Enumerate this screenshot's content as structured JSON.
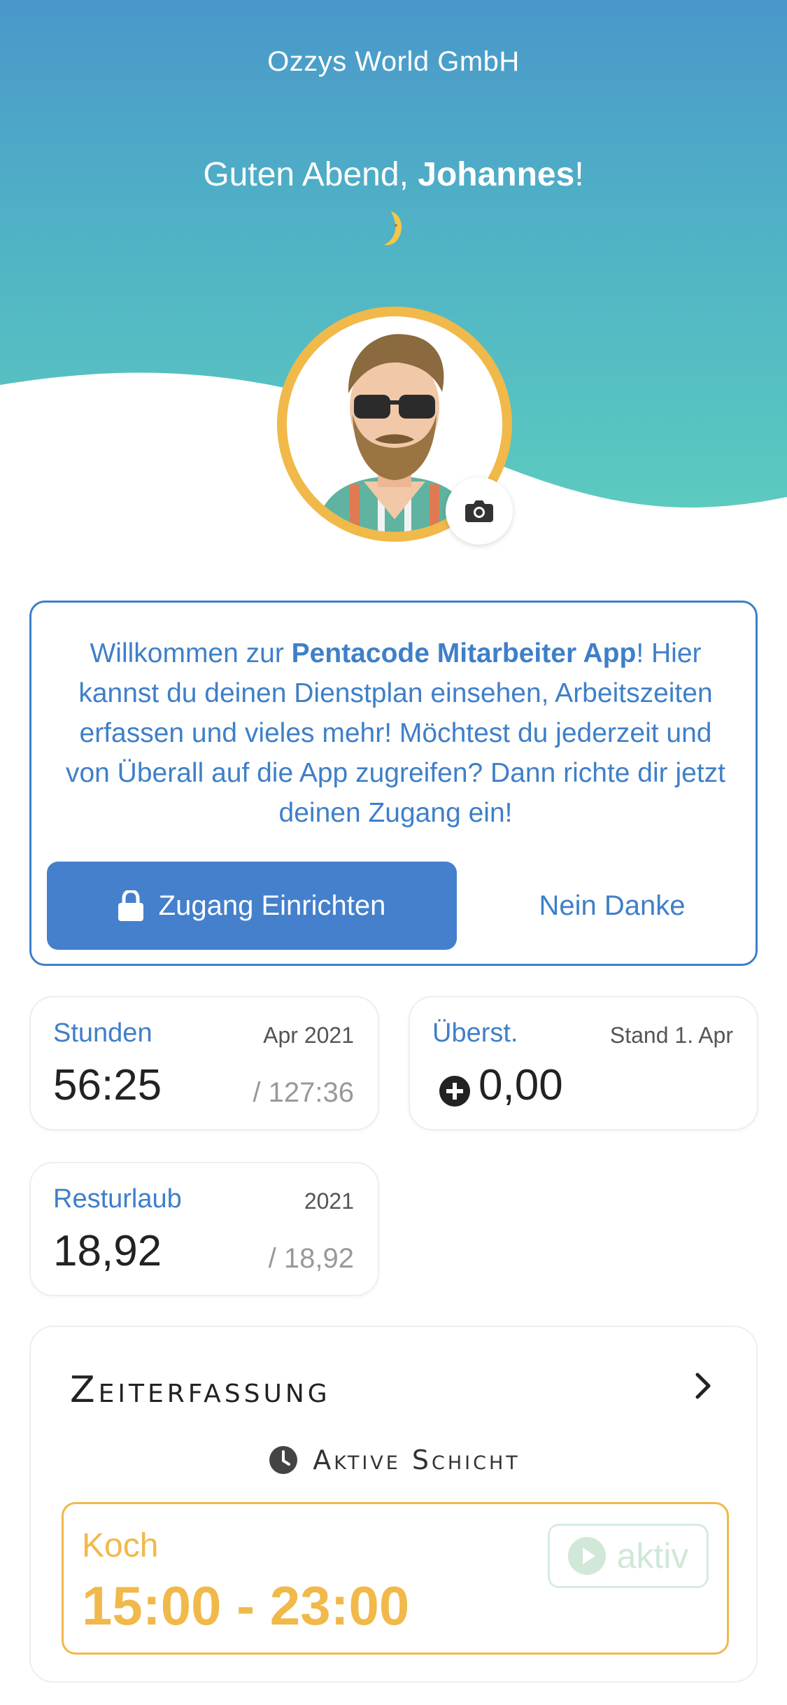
{
  "header": {
    "company": "Ozzys World GmbH",
    "greeting_prefix": "Guten Abend,",
    "user_name": "Johannes",
    "greeting_suffix": "!",
    "moon_icon": "crescent-moon-icon"
  },
  "profile": {
    "camera_icon": "camera-icon"
  },
  "welcome": {
    "text_before": "Willkommen zur ",
    "app_name": "Pentacode Mitarbeiter App",
    "text_after": "! Hier kannst du deinen Dienstplan einsehen, Arbeitszeiten erfassen und vieles mehr! Möchtest du jederzeit und von Überall auf die App zugreifen? Dann richte dir jetzt deinen Zugang ein!",
    "primary_button": "Zugang Einrichten",
    "secondary_button": "Nein Danke"
  },
  "stats": {
    "hours": {
      "label": "Stunden",
      "period": "Apr 2021",
      "value": "56:25",
      "total": "/ 127:36"
    },
    "overtime": {
      "label": "Überst.",
      "period": "Stand 1. Apr",
      "value": "0,00"
    },
    "vacation": {
      "label": "Resturlaub",
      "period": "2021",
      "value": "18,92",
      "total": "/ 18,92"
    }
  },
  "time_tracking": {
    "title": "Zeiterfassung",
    "active_shift_label": "Aktive Schicht",
    "shift": {
      "role": "Koch",
      "time": "15:00 - 23:00",
      "status": "aktiv"
    }
  },
  "colors": {
    "accent_blue": "#3f7fc8",
    "accent_gold": "#f0b94a",
    "status_green": "#cfe8d7"
  }
}
